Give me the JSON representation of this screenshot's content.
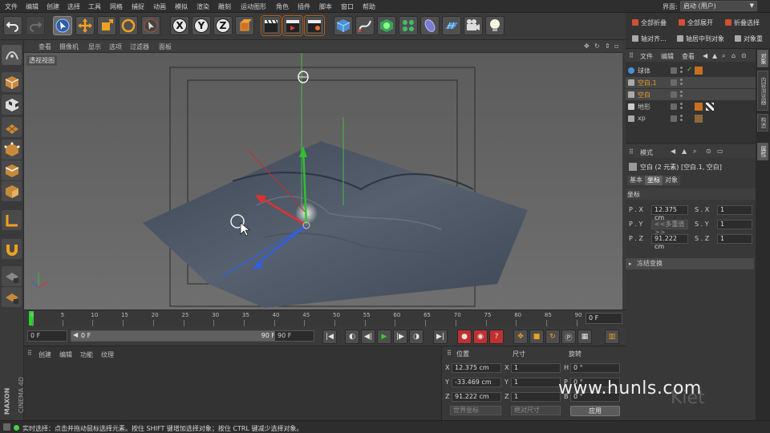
{
  "menubar": {
    "items": [
      "文件",
      "编辑",
      "创建",
      "选择",
      "工具",
      "网格",
      "捕捉",
      "动画",
      "模拟",
      "渲染",
      "雕刻",
      "运动图形",
      "角色",
      "插件",
      "脚本",
      "窗口",
      "帮助"
    ],
    "layout_label": "界面:",
    "layout_value": "启动 (用户)"
  },
  "right_panel": {
    "buttons": [
      "全部折叠",
      "全部展开",
      "折叠选择",
      "轴对齐...",
      "轴居中到对象",
      "对象重"
    ]
  },
  "viewport": {
    "menu": [
      "查看",
      "摄像机",
      "显示",
      "选项",
      "过滤器",
      "面板"
    ],
    "label": "透视视图"
  },
  "timeline": {
    "ticks": [
      "0",
      "5",
      "10",
      "15",
      "20",
      "25",
      "30",
      "35",
      "40",
      "45",
      "50",
      "55",
      "60",
      "65",
      "70",
      "75",
      "80",
      "85",
      "90"
    ],
    "current_frame": "0 F"
  },
  "transport": {
    "start_frame": "0 F",
    "range_start": "0 F",
    "range_end": "90 F",
    "end_frame": "90 F"
  },
  "material_manager": {
    "menu": [
      "创建",
      "编辑",
      "功能",
      "纹理"
    ]
  },
  "brand": {
    "line1": "MAXON",
    "line2": "CINEMA 4D"
  },
  "coordinates": {
    "headers": {
      "position": "位置",
      "size": "尺寸",
      "rotation": "旋转"
    },
    "rows": [
      {
        "axis": "X",
        "pos": "12.375 cm",
        "size_axis": "X",
        "size": "1",
        "rot_axis": "H",
        "rot": "0 °"
      },
      {
        "axis": "Y",
        "pos": "-33.469 cm",
        "size_axis": "Y",
        "size": "1",
        "rot_axis": "P",
        "rot": "0 °"
      },
      {
        "axis": "Z",
        "pos": "91.222 cm",
        "size_axis": "Z",
        "size": "1",
        "rot_axis": "B",
        "rot": "0 °"
      }
    ],
    "coord_mode": "世界坐标",
    "scale_mode": "绝对尺寸",
    "apply": "应用"
  },
  "status": {
    "text": "实时选择：点击并拖动鼠标选择元素。按住 SHIFT 键增加选择对象；按住 CTRL 键减少选择对象。"
  },
  "object_manager": {
    "menu": [
      "文件",
      "编辑",
      "查看"
    ],
    "objects": [
      {
        "name": "球体",
        "selected": false,
        "highlight": false
      },
      {
        "name": "空白.1",
        "selected": true,
        "highlight": true
      },
      {
        "name": "空白",
        "selected": true,
        "highlight": true
      },
      {
        "name": "地形",
        "selected": false,
        "highlight": false
      },
      {
        "name": "xp",
        "selected": false,
        "highlight": false
      }
    ]
  },
  "side_tabs": [
    "对象",
    "内容浏览器",
    "构造",
    "属性"
  ],
  "attribute_manager": {
    "menu": "模式",
    "title": "空白 (2 元素) [空白.1, 空白]",
    "tabs": [
      "基本",
      "坐标",
      "对象"
    ],
    "section": "坐标",
    "fields": [
      {
        "p_label": "P . X",
        "p_val": "12.375 cm",
        "s_label": "S . X",
        "s_val": "1"
      },
      {
        "p_label": "P . Y",
        "p_val": "<<多重值>>",
        "s_label": "S . Y",
        "s_val": "1"
      },
      {
        "p_label": "P . Z",
        "p_val": "91.222 cm",
        "s_label": "S . Z",
        "s_val": "1"
      }
    ],
    "freeze": "冻结变换"
  },
  "watermark": {
    "text": "www.hunls.com",
    "sub": "Kiet"
  },
  "colors": {
    "accent": "#f0a020",
    "play_green": "#2fd12f",
    "axis_red": "#e03030",
    "axis_green": "#30c030",
    "axis_blue": "#3060e0"
  }
}
